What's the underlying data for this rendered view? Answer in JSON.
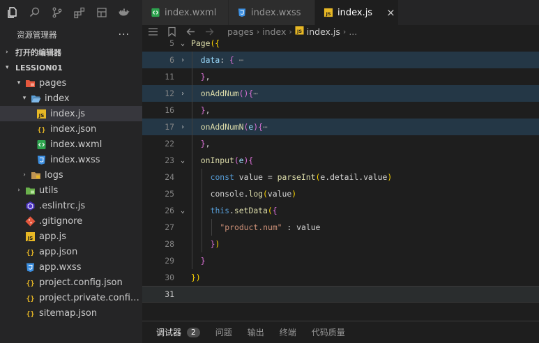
{
  "activity_icons": [
    "files-icon",
    "search-icon",
    "source-control-icon",
    "extensions-icon",
    "remote-icon",
    "docker-icon"
  ],
  "explorer": {
    "title": "资源管理器",
    "more": "···",
    "open_editors": "打开的编辑器",
    "project": "LESSION01"
  },
  "tree": [
    {
      "label": "pages",
      "depth": 1,
      "chev": "▾",
      "icon": "folder-pages"
    },
    {
      "label": "index",
      "depth": 2,
      "chev": "▾",
      "icon": "folder-open"
    },
    {
      "label": "index.js",
      "depth": 3,
      "chev": "",
      "icon": "js",
      "selected": true
    },
    {
      "label": "index.json",
      "depth": 3,
      "chev": "",
      "icon": "json"
    },
    {
      "label": "index.wxml",
      "depth": 3,
      "chev": "",
      "icon": "wxml"
    },
    {
      "label": "index.wxss",
      "depth": 3,
      "chev": "",
      "icon": "wxss"
    },
    {
      "label": "logs",
      "depth": 2,
      "chev": "›",
      "icon": "folder"
    },
    {
      "label": "utils",
      "depth": 1,
      "chev": "›",
      "icon": "folder-utils"
    },
    {
      "label": ".eslintrc.js",
      "depth": 1,
      "chev": "",
      "icon": "eslint"
    },
    {
      "label": ".gitignore",
      "depth": 1,
      "chev": "",
      "icon": "git"
    },
    {
      "label": "app.js",
      "depth": 1,
      "chev": "",
      "icon": "js"
    },
    {
      "label": "app.json",
      "depth": 1,
      "chev": "",
      "icon": "json"
    },
    {
      "label": "app.wxss",
      "depth": 1,
      "chev": "",
      "icon": "wxss"
    },
    {
      "label": "project.config.json",
      "depth": 1,
      "chev": "",
      "icon": "json"
    },
    {
      "label": "project.private.config.js...",
      "depth": 1,
      "chev": "",
      "icon": "json"
    },
    {
      "label": "sitemap.json",
      "depth": 1,
      "chev": "",
      "icon": "json"
    }
  ],
  "tabs": [
    {
      "label": "index.wxml",
      "icon": "wxml",
      "active": false
    },
    {
      "label": "index.wxss",
      "icon": "wxss",
      "active": false
    },
    {
      "label": "index.js",
      "icon": "js",
      "active": true
    }
  ],
  "tab_close": "×",
  "breadcrumb": {
    "parts": [
      "pages",
      "index"
    ],
    "file": "index.js",
    "tail": "..."
  },
  "code_lines": [
    {
      "n": "5",
      "fold": "v",
      "indent": 0,
      "tokens": [
        [
          "t-fn",
          "Page"
        ],
        [
          "t-yl",
          "({"
        ]
      ]
    },
    {
      "n": "6",
      "fold": ">",
      "indent": 1,
      "hl": true,
      "tokens": [
        [
          "t-prop",
          "data"
        ],
        [
          "t-punc",
          ": "
        ],
        [
          "t-br",
          "{"
        ],
        [
          "t-ell",
          " ⋯"
        ]
      ]
    },
    {
      "n": "11",
      "fold": "",
      "indent": 1,
      "tokens": [
        [
          "t-br",
          "}"
        ],
        [
          "t-punc",
          ","
        ]
      ]
    },
    {
      "n": "12",
      "fold": ">",
      "indent": 1,
      "hl": true,
      "tokens": [
        [
          "t-fn",
          "onAddNum"
        ],
        [
          "t-br",
          "()"
        ],
        [
          "t-br",
          "{"
        ],
        [
          "t-ell",
          "⋯"
        ]
      ]
    },
    {
      "n": "16",
      "fold": "",
      "indent": 1,
      "tokens": [
        [
          "t-br",
          "}"
        ],
        [
          "t-punc",
          ","
        ]
      ]
    },
    {
      "n": "17",
      "fold": ">",
      "indent": 1,
      "hl": true,
      "tokens": [
        [
          "t-fn",
          "onAddNumN"
        ],
        [
          "t-br",
          "("
        ],
        [
          "t-prop",
          "e"
        ],
        [
          "t-br",
          ")"
        ],
        [
          "t-br",
          "{"
        ],
        [
          "t-ell",
          "⋯"
        ]
      ]
    },
    {
      "n": "22",
      "fold": "",
      "indent": 1,
      "tokens": [
        [
          "t-br",
          "}"
        ],
        [
          "t-punc",
          ","
        ]
      ]
    },
    {
      "n": "23",
      "fold": "v",
      "indent": 1,
      "tokens": [
        [
          "t-fn",
          "onInput"
        ],
        [
          "t-br",
          "("
        ],
        [
          "t-prop",
          "e"
        ],
        [
          "t-br",
          ")"
        ],
        [
          "t-br",
          "{"
        ]
      ]
    },
    {
      "n": "24",
      "fold": "",
      "indent": 2,
      "tokens": [
        [
          "t-kw",
          "const "
        ],
        [
          "t-var",
          "value"
        ],
        [
          "t-punc",
          " = "
        ],
        [
          "t-fn",
          "parseInt"
        ],
        [
          "t-yl",
          "("
        ],
        [
          "t-var",
          "e.detail.value"
        ],
        [
          "t-yl",
          ")"
        ]
      ]
    },
    {
      "n": "25",
      "fold": "",
      "indent": 2,
      "tokens": [
        [
          "t-var",
          "console"
        ],
        [
          "t-punc",
          "."
        ],
        [
          "t-fn",
          "log"
        ],
        [
          "t-yl",
          "("
        ],
        [
          "t-var",
          "value"
        ],
        [
          "t-yl",
          ")"
        ]
      ]
    },
    {
      "n": "26",
      "fold": "v",
      "indent": 2,
      "tokens": [
        [
          "t-kw",
          "this"
        ],
        [
          "t-punc",
          "."
        ],
        [
          "t-fn",
          "setData"
        ],
        [
          "t-yl",
          "("
        ],
        [
          "t-br",
          "{"
        ]
      ]
    },
    {
      "n": "27",
      "fold": "",
      "indent": 3,
      "tokens": [
        [
          "t-str",
          "\"product.num\""
        ],
        [
          "t-punc",
          " : "
        ],
        [
          "t-var",
          "value"
        ]
      ]
    },
    {
      "n": "28",
      "fold": "",
      "indent": 2,
      "tokens": [
        [
          "t-br",
          "}"
        ],
        [
          "t-yl",
          ")"
        ]
      ]
    },
    {
      "n": "29",
      "fold": "",
      "indent": 1,
      "tokens": [
        [
          "t-br",
          "}"
        ]
      ]
    },
    {
      "n": "30",
      "fold": "",
      "indent": 0,
      "tokens": [
        [
          "t-yl",
          "})"
        ]
      ]
    },
    {
      "n": "31",
      "fold": "",
      "indent": 0,
      "cursor": true,
      "tokens": []
    }
  ],
  "panel": {
    "tabs": [
      "调试器",
      "问题",
      "输出",
      "终端",
      "代码质量"
    ],
    "badge": "2"
  }
}
